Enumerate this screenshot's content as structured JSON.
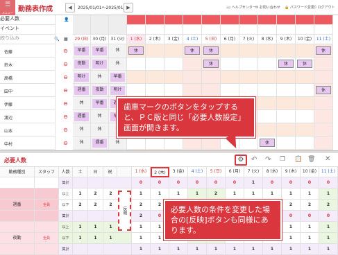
{
  "topbar": {
    "menu_icon": "hamburger-icon",
    "menu_caption": "メニュー",
    "title": "勤務表作成",
    "prev_label": "◀",
    "next_label": "▶",
    "date_range": "2025/01/01～2025/01/31",
    "help_label": "ヘルプセンター",
    "contact_label": "お問い合わせ",
    "password_label": "パスワード変更",
    "logout_label": "ログアウト"
  },
  "schedule": {
    "row_required": "必要人数",
    "row_event": "イベント",
    "filter_placeholder": "絞り込み",
    "prev_days": [
      {
        "label": "29 (日)"
      },
      {
        "label": "30 (月)"
      },
      {
        "label": "31 (火)"
      }
    ],
    "days": [
      {
        "label": "1 (水)"
      },
      {
        "label": "2 (木)"
      },
      {
        "label": "3 (金)"
      },
      {
        "label": "4 (土)"
      },
      {
        "label": "5 (日)"
      },
      {
        "label": "6 (月)"
      },
      {
        "label": "7 (火)"
      },
      {
        "label": "8 (水)"
      },
      {
        "label": "9 (木)"
      },
      {
        "label": "10 (金)"
      },
      {
        "label": "11 (土)"
      }
    ],
    "staff": [
      "佐藤",
      "鈴木",
      "高橋",
      "田中",
      "伊藤",
      "渡辺",
      "山本",
      "中村",
      "小林"
    ],
    "prev_shifts": [
      [
        "早番",
        "早番",
        "休"
      ],
      [
        "夜勤",
        "明け",
        "休"
      ],
      [
        "明け",
        "休",
        "早番"
      ],
      [
        "週番",
        "夜勤",
        "明け"
      ],
      [
        "休",
        "早番",
        "遅番"
      ],
      [
        "遅番",
        "休",
        "早番"
      ],
      [
        "休",
        "休",
        "休"
      ],
      [
        "休",
        "遅番",
        "休"
      ],
      [
        "夜勤",
        "明け",
        "休"
      ]
    ],
    "month_shifts": [
      {
        "row": 0,
        "col": 0,
        "label": "休"
      },
      {
        "row": 0,
        "col": 3,
        "label": "休"
      },
      {
        "row": 0,
        "col": 4,
        "label": "休"
      },
      {
        "row": 0,
        "col": 10,
        "label": "休"
      },
      {
        "row": 1,
        "col": 4,
        "label": "休"
      },
      {
        "row": 1,
        "col": 8,
        "label": "休"
      },
      {
        "row": 1,
        "col": 9,
        "label": "休"
      },
      {
        "row": 4,
        "col": 3,
        "label": "休"
      },
      {
        "row": 5,
        "col": 5,
        "label": "番"
      },
      {
        "row": 7,
        "col": 7,
        "label": "休"
      },
      {
        "row": 3,
        "col": 10,
        "label": "休"
      }
    ]
  },
  "callout1": {
    "text": "歯車マークのボタンをタップすると、ＰＣ版と同じ「必要人数設定」画面が開きます。"
  },
  "callout2": {
    "text": "必要人数の条件を変更した場合の[反映]ボタンも同様にあります。"
  },
  "panel": {
    "title": "必要人数",
    "headers": {
      "type": "勤務種別",
      "staff": "スタッフ",
      "count": "人数",
      "sat": "土",
      "sun": "日",
      "hol": "祝"
    },
    "days": [
      "1 (水)",
      "2 (木)",
      "3 (金)",
      "4 (土)",
      "5 (日)",
      "6 (月)",
      "7 (火)",
      "8 (水)",
      "9 (木)",
      "10 (金)",
      "11 (土)"
    ],
    "reflect_label": "反映",
    "rows": [
      {
        "type": "",
        "staff": "",
        "kind": "集計",
        "sat": "",
        "sun": "",
        "hol": "",
        "vals": [
          "0",
          "0",
          "0",
          "0",
          "0",
          "0",
          "1",
          "0",
          "0",
          "0",
          "0"
        ]
      },
      {
        "type": "",
        "staff": "",
        "kind": "以上",
        "sat": "1",
        "sun": "2",
        "hol": "2",
        "vals": [
          "1",
          "1",
          "1",
          "1",
          "2",
          "1",
          "1",
          "1",
          "1",
          "1",
          "1"
        ]
      },
      {
        "type": "週番",
        "staff": "全員",
        "kind": "以下",
        "sat": "2",
        "sun": "2",
        "hol": "2",
        "vals": [
          "2",
          "2",
          "2",
          "2",
          "2",
          "2",
          "2",
          "2",
          "2",
          "2",
          "2"
        ]
      },
      {
        "type": "",
        "staff": "",
        "kind": "集計",
        "sat": "",
        "sun": "",
        "hol": "",
        "vals": [
          "2",
          "0",
          "0",
          "0",
          "0",
          "0",
          "1",
          "0",
          "0",
          "0",
          "0"
        ]
      },
      {
        "type": "",
        "staff": "",
        "kind": "以上",
        "sat": "1",
        "sun": "1",
        "hol": "1",
        "vals": [
          "1",
          "1",
          "1",
          "1",
          "1",
          "1",
          "1",
          "1",
          "1",
          "1",
          "1"
        ]
      },
      {
        "type": "夜勤",
        "staff": "全員",
        "kind": "以下",
        "sat": "1",
        "sun": "1",
        "hol": "1",
        "vals": [
          "1",
          "1",
          "1",
          "1",
          "1",
          "1",
          "1",
          "1",
          "1",
          "1",
          "1"
        ]
      },
      {
        "type": "",
        "staff": "",
        "kind": "集計",
        "sat": "",
        "sun": "",
        "hol": "",
        "vals": [
          "1",
          "1",
          "1",
          "1",
          "1",
          "1",
          "1",
          "1",
          "1",
          "1",
          "1"
        ]
      }
    ],
    "toolbar_icons": [
      "gear-icon",
      "undo-icon",
      "redo-icon",
      "copy-icon",
      "paste-icon",
      "trash-icon",
      "close-icon"
    ]
  },
  "colors": {
    "accent": "#d9363e",
    "shift_fill": "#e8c7f1",
    "weekend_pink": "#fce7e3",
    "peach": "#fde9dc",
    "green_row": "#eaf6df",
    "lilac_row": "#f4ecfb"
  }
}
